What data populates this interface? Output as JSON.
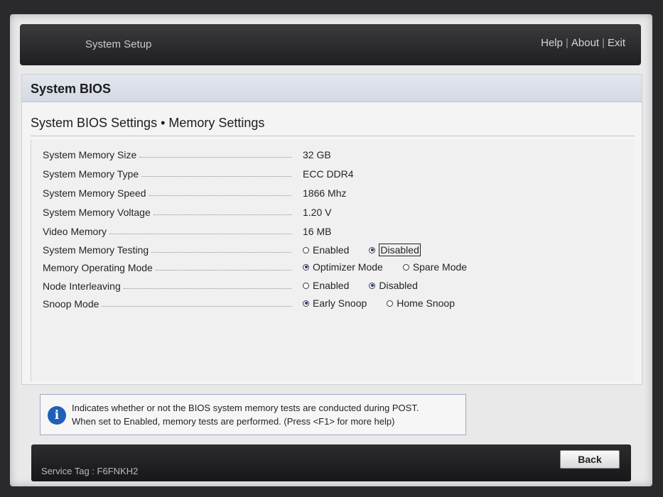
{
  "header": {
    "title": "System Setup",
    "links": [
      "Help",
      "About",
      "Exit"
    ]
  },
  "panel": {
    "heading": "System BIOS",
    "breadcrumb": "System BIOS Settings • Memory Settings"
  },
  "settings": [
    {
      "label": "System Memory Size",
      "value": "32 GB"
    },
    {
      "label": "System Memory Type",
      "value": "ECC DDR4"
    },
    {
      "label": "System Memory Speed",
      "value": "1866 Mhz"
    },
    {
      "label": "System Memory Voltage",
      "value": "1.20 V"
    },
    {
      "label": "Video Memory",
      "value": "16 MB"
    },
    {
      "label": "System Memory Testing",
      "options": [
        {
          "text": "Enabled",
          "selected": false
        },
        {
          "text": "Disabled",
          "selected": true
        }
      ]
    },
    {
      "label": "Memory Operating Mode",
      "options": [
        {
          "text": "Optimizer Mode",
          "selected": true
        },
        {
          "text": "Spare Mode",
          "selected": false
        }
      ]
    },
    {
      "label": "Node Interleaving",
      "options": [
        {
          "text": "Enabled",
          "selected": false
        },
        {
          "text": "Disabled",
          "selected": true
        }
      ]
    },
    {
      "label": "Snoop Mode",
      "options": [
        {
          "text": "Early Snoop",
          "selected": true
        },
        {
          "text": "Home Snoop",
          "selected": false
        }
      ]
    }
  ],
  "help": {
    "icon": "info-icon",
    "line1": "Indicates whether or not the BIOS system memory tests are conducted during POST.",
    "line2": "When set to Enabled, memory tests are performed. (Press <F1> for more help)"
  },
  "footer": {
    "service_tag": "Service Tag : F6FNKH2",
    "back_label": "Back"
  },
  "colors": {
    "accent": "#1f5fb8",
    "radio_fill": "#1f3c8c"
  }
}
